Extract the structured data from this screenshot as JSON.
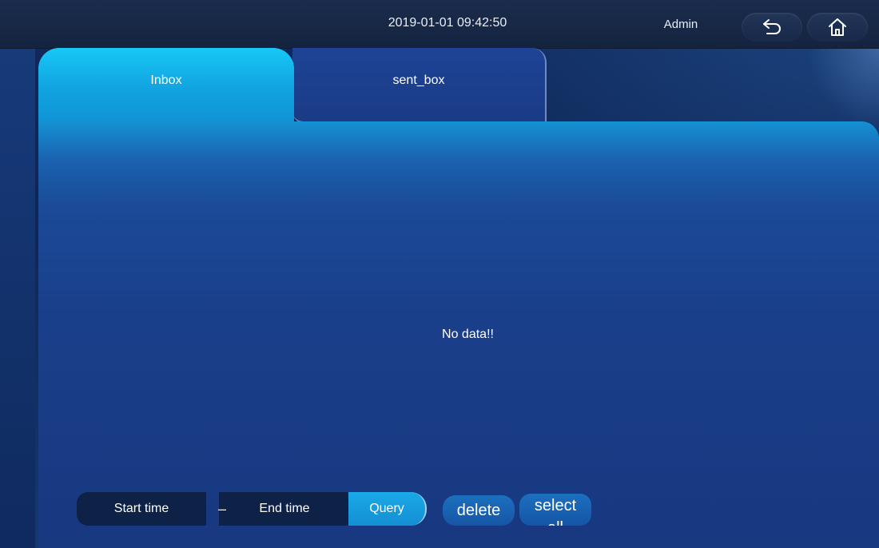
{
  "topbar": {
    "datetime": "2019-01-01 09:42:50",
    "user": "Admin",
    "icons": [
      "back-icon",
      "home-icon"
    ]
  },
  "tabs": [
    {
      "label": "Inbox",
      "active": true
    },
    {
      "label": "sent_box",
      "active": false
    }
  ],
  "main": {
    "empty_message": "No data!!"
  },
  "filter": {
    "start_time": "Start time",
    "separator": "–",
    "end_time": "End time",
    "query": "Query",
    "delete": "delete",
    "select_all": "select all"
  },
  "colors": {
    "active_tab": "#18c8f6",
    "panel": "#1a3f8a",
    "topbar": "#1b2c4d"
  }
}
